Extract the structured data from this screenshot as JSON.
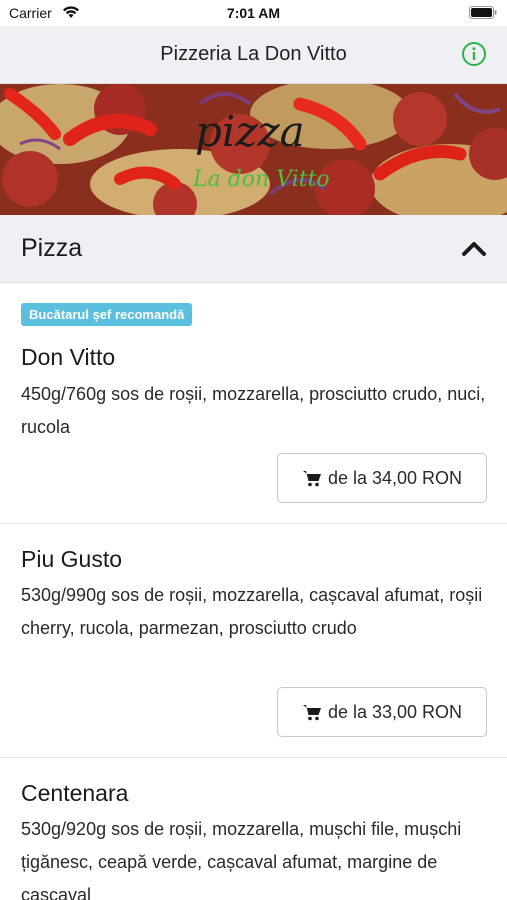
{
  "status_bar": {
    "carrier": "Carrier",
    "time": "7:01 AM"
  },
  "nav": {
    "title": "Pizzeria La Don Vitto",
    "info_icon": "info-circle-icon",
    "accent_color": "#2fb34a"
  },
  "banner": {
    "logo_line1": "pizza",
    "logo_line2": "La don Vitto"
  },
  "category": {
    "title": "Pizza",
    "toggle_icon": "chevron-up-icon"
  },
  "items": [
    {
      "badge": "Bucătarul șef recomandă",
      "name": "Don Vitto",
      "description": "450g/760g sos de roșii, mozzarella, prosciutto crudo, nuci, rucola",
      "price_label": "de la 34,00 RON"
    },
    {
      "name": "Piu Gusto",
      "description": "530g/990g sos de roșii, mozzarella, cașcaval afumat, roșii cherry, rucola, parmezan, prosciutto crudo",
      "price_label": "de la 33,00 RON"
    },
    {
      "name": "Centenara",
      "description": "530g/920g sos de roșii, mozzarella, mușchi file, mușchi țigănesc, ceapă verde, cașcaval afumat, margine de cașcaval"
    }
  ],
  "colors": {
    "badge": "#5bc0de",
    "header_bg": "#eef0f3"
  }
}
